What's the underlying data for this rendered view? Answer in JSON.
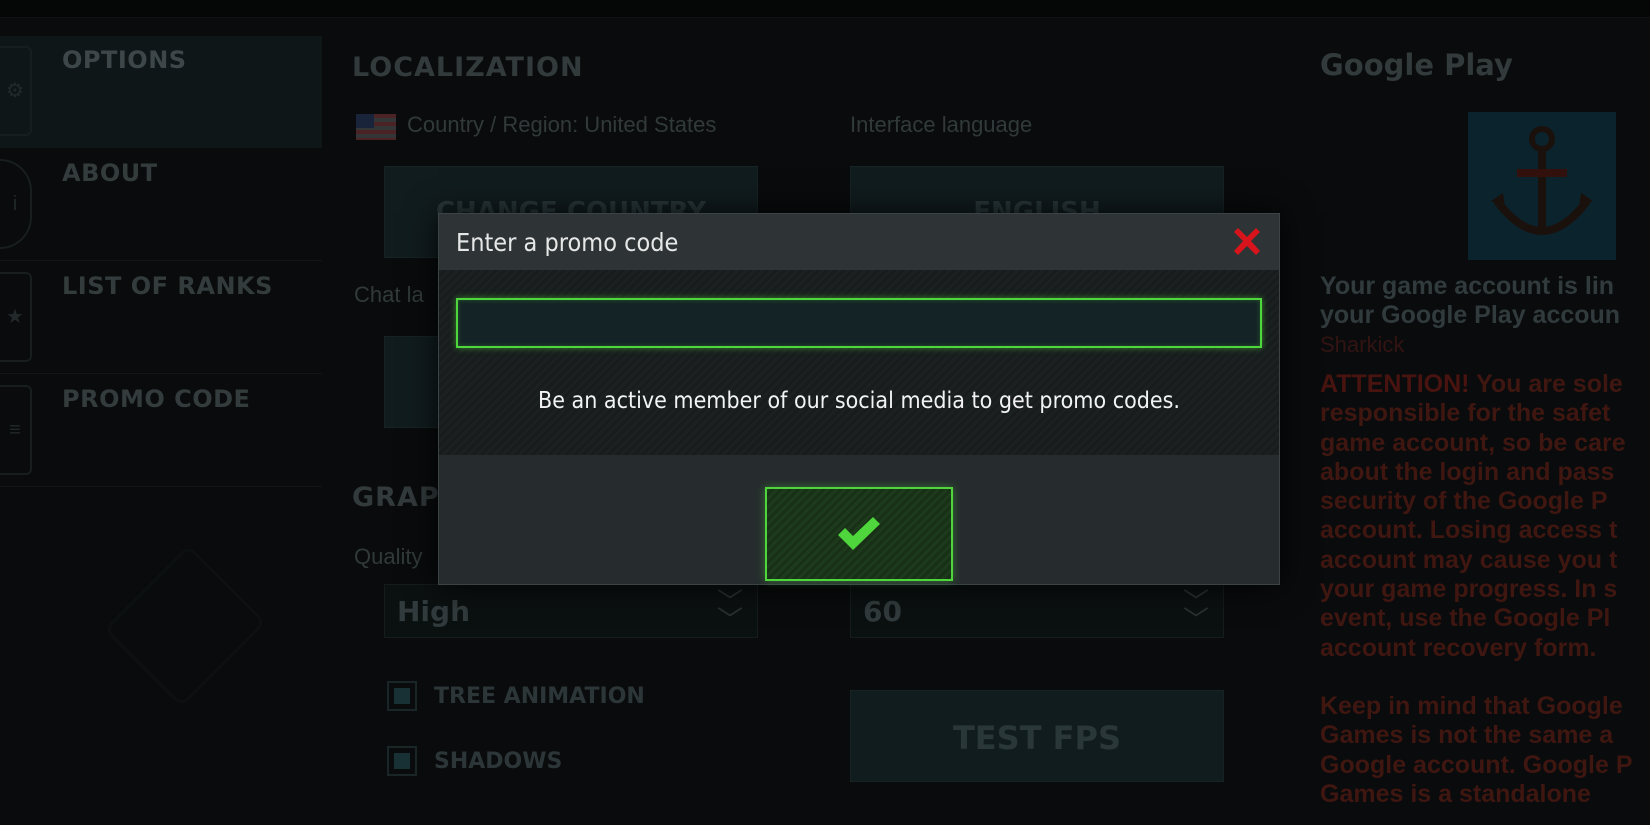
{
  "sidebar": {
    "items": [
      {
        "label": "OPTIONS",
        "active": true
      },
      {
        "label": "ABOUT",
        "active": false
      },
      {
        "label": "LIST OF RANKS",
        "active": false
      },
      {
        "label": "PROMO CODE",
        "active": false
      }
    ]
  },
  "localization": {
    "title": "LOCALIZATION",
    "country_label": "Country / Region: United States",
    "language_label": "Interface language",
    "change_country_button": "CHANGE COUNTRY",
    "language_button": "ENGLISH",
    "chat_label": "Chat la"
  },
  "graphics": {
    "title": "GRAP",
    "quality_label": "Quality",
    "quality_value": "High",
    "fps_value": "60",
    "test_fps_button": "TEST FPS",
    "options": [
      {
        "label": "TREE ANIMATION",
        "checked": true
      },
      {
        "label": "SHADOWS",
        "checked": true
      }
    ]
  },
  "google_play": {
    "title": "Google Play",
    "linked_text_1": "Your game account is lin",
    "linked_text_2": "your Google Play accoun",
    "linked_name": "Sharkick",
    "attention_label": "ATTENTION!",
    "warning_1": "You are sole responsible for the safet game account, so be care about the login and pass security of the Google P account. Losing access t account may cause you t your game progress. In s event, use the Google Pl account recovery form.",
    "warning_2": "Keep in mind that Google Games is not the same a Google account. Google P Games is a standalone"
  },
  "modal": {
    "title": "Enter a promo code",
    "input_value": "",
    "input_placeholder": "",
    "hint": "Be an active member of our social media to get promo codes.",
    "close_icon": "close-icon",
    "confirm_icon": "checkmark-icon"
  },
  "colors": {
    "accent_green": "#4fd63c",
    "close_red": "#d7141c",
    "warning_red": "#561712"
  }
}
